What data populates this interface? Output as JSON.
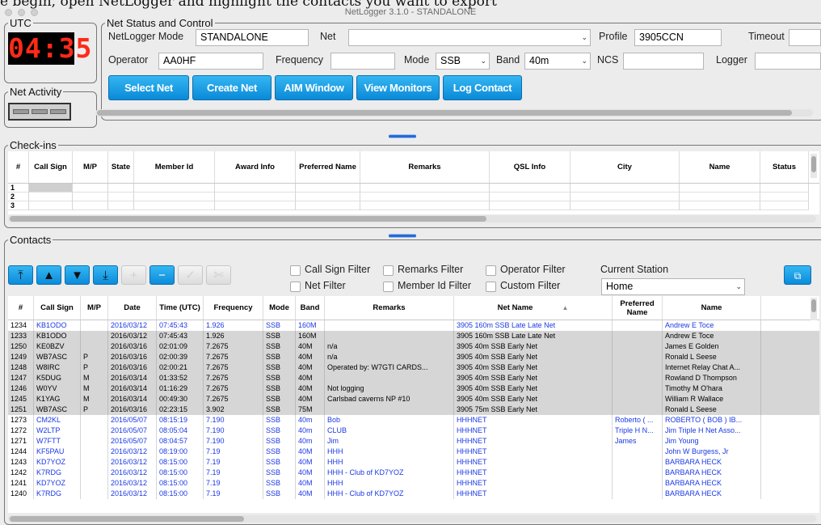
{
  "top_strip_text": "e begin, open NetLogger and highlight the contacts you want to export",
  "window": {
    "title": "NetLogger 3.1.0 - STANDALONE"
  },
  "utc": {
    "legend": "UTC",
    "time": "04:35"
  },
  "net_activity": {
    "legend": "Net Activity"
  },
  "net_status": {
    "legend": "Net Status and Control",
    "mode_label": "NetLogger Mode",
    "mode_value": "STANDALONE",
    "net_label": "Net",
    "net_value": "",
    "profile_label": "Profile",
    "profile_value": "3905CCN",
    "timeout_label": "Timeout",
    "timeout_value": "",
    "operator_label": "Operator",
    "operator_value": "AA0HF",
    "frequency_label": "Frequency",
    "frequency_value": "",
    "opmode_label": "Mode",
    "opmode_value": "SSB",
    "band_label": "Band",
    "band_value": "40m",
    "ncs_label": "NCS",
    "ncs_value": "",
    "logger_label": "Logger",
    "logger_value": "",
    "buttons": [
      "Select Net",
      "Create Net",
      "AIM Window",
      "View Monitors",
      "Log Contact"
    ]
  },
  "checkins": {
    "legend": "Check-ins",
    "columns": [
      "#",
      "Call Sign",
      "M/P",
      "State",
      "Member Id",
      "Award Info",
      "Preferred Name",
      "Remarks",
      "QSL Info",
      "City",
      "Name",
      "Status"
    ],
    "rows": [
      "1",
      "2",
      "3"
    ]
  },
  "contacts": {
    "legend": "Contacts",
    "filters": {
      "call_sign": "Call Sign Filter",
      "remarks": "Remarks Filter",
      "operator": "Operator Filter",
      "net": "Net Filter",
      "member_id": "Member Id Filter",
      "custom": "Custom Filter"
    },
    "current_station_label": "Current Station",
    "current_station_value": "Home",
    "sort_indicator": "▲",
    "columns": [
      "#",
      "Call Sign",
      "M/P",
      "Date",
      "Time (UTC)",
      "Frequency",
      "Mode",
      "Band",
      "Remarks",
      "Net Name",
      "Preferred Name",
      "Name"
    ],
    "rows": [
      {
        "style": "wht",
        "cells": [
          "1234",
          "KB1ODO",
          "",
          "2016/03/12",
          "07:45:43",
          "1.926",
          "SSB",
          "160M",
          "",
          "3905 160m SSB Late Late Net",
          "",
          "Andrew E Toce"
        ]
      },
      {
        "style": "gray",
        "cells": [
          "1233",
          "KB1ODO",
          "",
          "2016/03/12",
          "07:45:43",
          "1.926",
          "SSB",
          "160M",
          "",
          "3905 160m SSB Late Late Net",
          "",
          "Andrew E Toce"
        ]
      },
      {
        "style": "gray",
        "cells": [
          "1250",
          "KE0BZV",
          "",
          "2016/03/16",
          "02:01:09",
          "7.2675",
          "SSB",
          "40M",
          "n/a",
          "3905 40m SSB Early Net",
          "",
          "James E Golden"
        ]
      },
      {
        "style": "gray",
        "cells": [
          "1249",
          "WB7ASC",
          "P",
          "2016/03/16",
          "02:00:39",
          "7.2675",
          "SSB",
          "40M",
          "n/a",
          "3905 40m SSB Early Net",
          "",
          "Ronald L Seese"
        ]
      },
      {
        "style": "gray",
        "cells": [
          "1248",
          "W8IRC",
          "P",
          "2016/03/16",
          "02:00:21",
          "7.2675",
          "SSB",
          "40M",
          "Operated by: W7GTI CARDS...",
          "3905 40m SSB Early Net",
          "",
          "Internet Relay Chat A..."
        ]
      },
      {
        "style": "gray",
        "cells": [
          "1247",
          "K5DUG",
          "M",
          "2016/03/14",
          "01:33:52",
          "7.2675",
          "SSB",
          "40M",
          "",
          "3905 40m SSB Early Net",
          "",
          "Rowland D Thompson"
        ]
      },
      {
        "style": "gray",
        "cells": [
          "1246",
          "W0YV",
          "M",
          "2016/03/14",
          "01:16:29",
          "7.2675",
          "SSB",
          "40M",
          "Not logging",
          "3905 40m SSB Early Net",
          "",
          "Timothy M O'hara"
        ]
      },
      {
        "style": "gray",
        "cells": [
          "1245",
          "K1YAG",
          "M",
          "2016/03/14",
          "00:49:30",
          "7.2675",
          "SSB",
          "40M",
          "Carlsbad caverns NP #10",
          "3905 40m SSB Early Net",
          "",
          "William R Wallace"
        ]
      },
      {
        "style": "gray",
        "cells": [
          "1251",
          "WB7ASC",
          "P",
          "2016/03/16",
          "02:23:15",
          "3.902",
          "SSB",
          "75M",
          "",
          "3905 75m SSB Early Net",
          "",
          "Ronald L Seese"
        ]
      },
      {
        "style": "wht",
        "cells": [
          "1273",
          "CM2KL",
          "",
          "2016/05/07",
          "08:15:19",
          "7.190",
          "SSB",
          "40m",
          "Bob",
          "HHHNET",
          "Roberto ( ...",
          "ROBERTO ( BOB ) IB..."
        ]
      },
      {
        "style": "wht",
        "cells": [
          "1272",
          "W2LTP",
          "",
          "2016/05/07",
          "08:05:04",
          "7.190",
          "SSB",
          "40m",
          "CLUB",
          "HHHNET",
          "Triple H N...",
          "Jim Triple H Net Asso..."
        ]
      },
      {
        "style": "wht",
        "cells": [
          "1271",
          "W7FTT",
          "",
          "2016/05/07",
          "08:04:57",
          "7.190",
          "SSB",
          "40m",
          "Jim",
          "HHHNET",
          "James",
          "Jim Young"
        ]
      },
      {
        "style": "wht",
        "cells": [
          "1244",
          "KF5PAU",
          "",
          "2016/03/12",
          "08:19:00",
          "7.19",
          "SSB",
          "40M",
          "HHH",
          "HHHNET",
          "",
          "John W Burgess, Jr"
        ]
      },
      {
        "style": "wht",
        "cells": [
          "1243",
          "KD7YOZ",
          "",
          "2016/03/12",
          "08:15:00",
          "7.19",
          "SSB",
          "40M",
          "HHH",
          "HHHNET",
          "",
          "BARBARA HECK"
        ]
      },
      {
        "style": "wht",
        "cells": [
          "1242",
          "K7RDG",
          "",
          "2016/03/12",
          "08:15:00",
          "7.19",
          "SSB",
          "40M",
          "HHH - Club of KD7YOZ",
          "HHHNET",
          "",
          "BARBARA HECK"
        ]
      },
      {
        "style": "wht",
        "cells": [
          "1241",
          "KD7YOZ",
          "",
          "2016/03/12",
          "08:15:00",
          "7.19",
          "SSB",
          "40M",
          "HHH",
          "HHHNET",
          "",
          "BARBARA HECK"
        ]
      },
      {
        "style": "wht",
        "cells": [
          "1240",
          "K7RDG",
          "",
          "2016/03/12",
          "08:15:00",
          "7.19",
          "SSB",
          "40M",
          "HHH - Club of KD7YOZ",
          "HHHNET",
          "",
          "BARBARA HECK"
        ]
      }
    ]
  }
}
